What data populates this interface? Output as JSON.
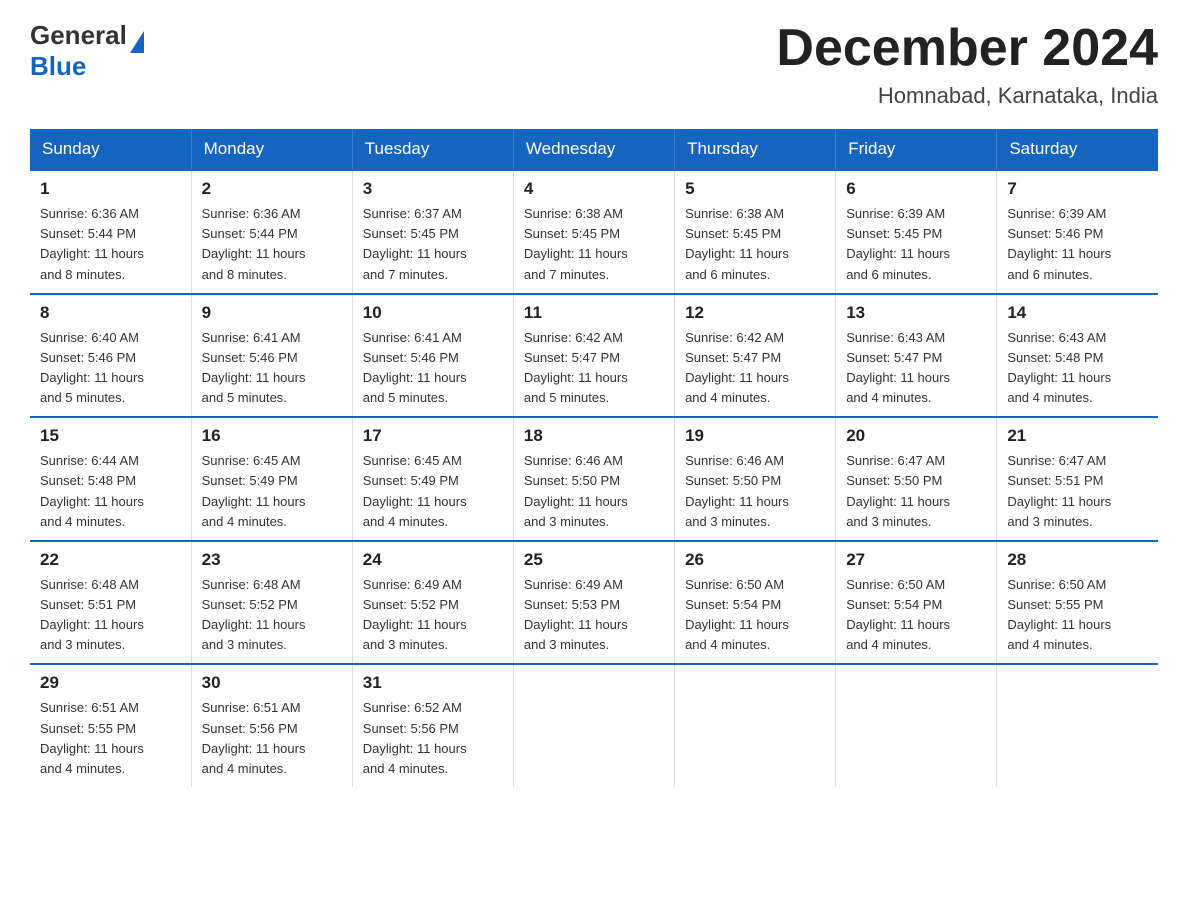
{
  "logo": {
    "text_general": "General",
    "text_blue": "Blue",
    "triangle": "▲"
  },
  "title": "December 2024",
  "subtitle": "Homnabad, Karnataka, India",
  "days_of_week": [
    "Sunday",
    "Monday",
    "Tuesday",
    "Wednesday",
    "Thursday",
    "Friday",
    "Saturday"
  ],
  "weeks": [
    [
      {
        "day": "1",
        "sunrise": "6:36 AM",
        "sunset": "5:44 PM",
        "daylight": "11 hours and 8 minutes."
      },
      {
        "day": "2",
        "sunrise": "6:36 AM",
        "sunset": "5:44 PM",
        "daylight": "11 hours and 8 minutes."
      },
      {
        "day": "3",
        "sunrise": "6:37 AM",
        "sunset": "5:45 PM",
        "daylight": "11 hours and 7 minutes."
      },
      {
        "day": "4",
        "sunrise": "6:38 AM",
        "sunset": "5:45 PM",
        "daylight": "11 hours and 7 minutes."
      },
      {
        "day": "5",
        "sunrise": "6:38 AM",
        "sunset": "5:45 PM",
        "daylight": "11 hours and 6 minutes."
      },
      {
        "day": "6",
        "sunrise": "6:39 AM",
        "sunset": "5:45 PM",
        "daylight": "11 hours and 6 minutes."
      },
      {
        "day": "7",
        "sunrise": "6:39 AM",
        "sunset": "5:46 PM",
        "daylight": "11 hours and 6 minutes."
      }
    ],
    [
      {
        "day": "8",
        "sunrise": "6:40 AM",
        "sunset": "5:46 PM",
        "daylight": "11 hours and 5 minutes."
      },
      {
        "day": "9",
        "sunrise": "6:41 AM",
        "sunset": "5:46 PM",
        "daylight": "11 hours and 5 minutes."
      },
      {
        "day": "10",
        "sunrise": "6:41 AM",
        "sunset": "5:46 PM",
        "daylight": "11 hours and 5 minutes."
      },
      {
        "day": "11",
        "sunrise": "6:42 AM",
        "sunset": "5:47 PM",
        "daylight": "11 hours and 5 minutes."
      },
      {
        "day": "12",
        "sunrise": "6:42 AM",
        "sunset": "5:47 PM",
        "daylight": "11 hours and 4 minutes."
      },
      {
        "day": "13",
        "sunrise": "6:43 AM",
        "sunset": "5:47 PM",
        "daylight": "11 hours and 4 minutes."
      },
      {
        "day": "14",
        "sunrise": "6:43 AM",
        "sunset": "5:48 PM",
        "daylight": "11 hours and 4 minutes."
      }
    ],
    [
      {
        "day": "15",
        "sunrise": "6:44 AM",
        "sunset": "5:48 PM",
        "daylight": "11 hours and 4 minutes."
      },
      {
        "day": "16",
        "sunrise": "6:45 AM",
        "sunset": "5:49 PM",
        "daylight": "11 hours and 4 minutes."
      },
      {
        "day": "17",
        "sunrise": "6:45 AM",
        "sunset": "5:49 PM",
        "daylight": "11 hours and 4 minutes."
      },
      {
        "day": "18",
        "sunrise": "6:46 AM",
        "sunset": "5:50 PM",
        "daylight": "11 hours and 3 minutes."
      },
      {
        "day": "19",
        "sunrise": "6:46 AM",
        "sunset": "5:50 PM",
        "daylight": "11 hours and 3 minutes."
      },
      {
        "day": "20",
        "sunrise": "6:47 AM",
        "sunset": "5:50 PM",
        "daylight": "11 hours and 3 minutes."
      },
      {
        "day": "21",
        "sunrise": "6:47 AM",
        "sunset": "5:51 PM",
        "daylight": "11 hours and 3 minutes."
      }
    ],
    [
      {
        "day": "22",
        "sunrise": "6:48 AM",
        "sunset": "5:51 PM",
        "daylight": "11 hours and 3 minutes."
      },
      {
        "day": "23",
        "sunrise": "6:48 AM",
        "sunset": "5:52 PM",
        "daylight": "11 hours and 3 minutes."
      },
      {
        "day": "24",
        "sunrise": "6:49 AM",
        "sunset": "5:52 PM",
        "daylight": "11 hours and 3 minutes."
      },
      {
        "day": "25",
        "sunrise": "6:49 AM",
        "sunset": "5:53 PM",
        "daylight": "11 hours and 3 minutes."
      },
      {
        "day": "26",
        "sunrise": "6:50 AM",
        "sunset": "5:54 PM",
        "daylight": "11 hours and 4 minutes."
      },
      {
        "day": "27",
        "sunrise": "6:50 AM",
        "sunset": "5:54 PM",
        "daylight": "11 hours and 4 minutes."
      },
      {
        "day": "28",
        "sunrise": "6:50 AM",
        "sunset": "5:55 PM",
        "daylight": "11 hours and 4 minutes."
      }
    ],
    [
      {
        "day": "29",
        "sunrise": "6:51 AM",
        "sunset": "5:55 PM",
        "daylight": "11 hours and 4 minutes."
      },
      {
        "day": "30",
        "sunrise": "6:51 AM",
        "sunset": "5:56 PM",
        "daylight": "11 hours and 4 minutes."
      },
      {
        "day": "31",
        "sunrise": "6:52 AM",
        "sunset": "5:56 PM",
        "daylight": "11 hours and 4 minutes."
      },
      null,
      null,
      null,
      null
    ]
  ],
  "labels": {
    "sunrise": "Sunrise:",
    "sunset": "Sunset:",
    "daylight": "Daylight:"
  }
}
